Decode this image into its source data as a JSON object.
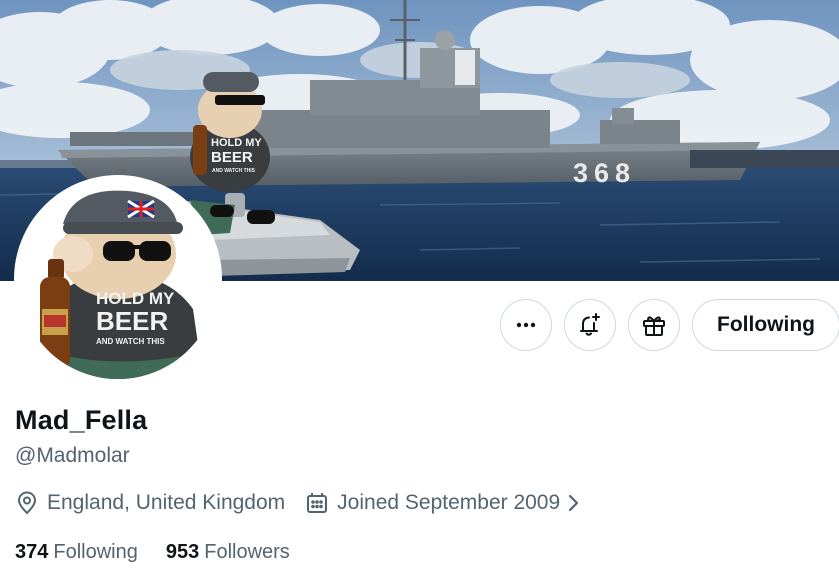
{
  "banner": {
    "ship_hull_number": "368",
    "sticker_text": [
      "HOLD MY",
      "BEER",
      "AND WATCH THIS"
    ]
  },
  "avatar": {
    "shirt_text": [
      "HOLD MY",
      "BEER",
      "AND WATCH THIS"
    ]
  },
  "actions": {
    "more_icon": "more-horizontal-icon",
    "notify_icon": "bell-plus-icon",
    "gift_icon": "gift-icon",
    "following_label": "Following"
  },
  "profile": {
    "display_name": "Mad_Fella",
    "handle": "@Madmolar",
    "location": "England, United Kingdom",
    "joined": "Joined September 2009",
    "following_count": "374",
    "following_label": "Following",
    "followers_count": "953",
    "followers_label": "Followers"
  },
  "colors": {
    "text_primary": "#0f1419",
    "text_secondary": "#536471",
    "border": "#cfd9de",
    "sky": "#7a9fc6",
    "sea": "#1e3d62",
    "ship": "#6e7780"
  }
}
